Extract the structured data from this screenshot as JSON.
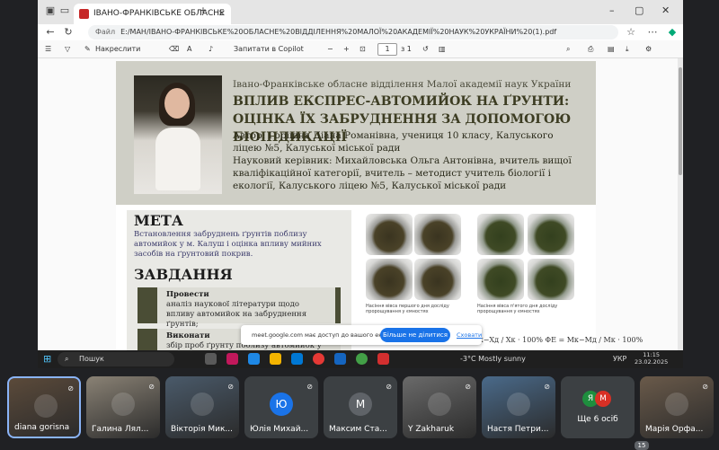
{
  "browser": {
    "tab_title": "ІВАНО-ФРАНКІВСЬКЕ ОБЛАСНЕ",
    "address_prefix": "Файл",
    "url": "E:/МАН/ІВАНО-ФРАНКІВСЬКЕ%20ОБЛАСНЕ%20ВІДДІЛЕННЯ%20МАЛОЇ%20АКАДЕМІЇ%20НАУК%20УКРАЇНИ%20(1).pdf"
  },
  "pdf_toolbar": {
    "highlight": "Накреслити",
    "ask_copilot": "Запитати в Copilot",
    "page": "1",
    "of_pages": "з 1"
  },
  "poster": {
    "org": "Івано-Франківське обласне відділення Малої академії наук України",
    "title": "ВПЛИВ ЕКСПРЕС-АВТОМИЙОК НА ҐРУНТИ: ОЦІНКА ЇХ ЗАБРУДНЕННЯ ЗА ДОПОМОГОЮ БІОІНДИКАЦІЇ",
    "author": "Автор: Горішна Діана Романівна, учениця 10 класу, Калуського ліцею №5, Калуської міської ради",
    "supervisor": "Науковий керівник: Михайловська Ольга Антонівна, вчитель вищої кваліфікаційної категорії, вчитель – методист учитель біології і екології, Калуського ліцею №5, Калуської міської ради",
    "goal_heading": "МЕТА",
    "goal_text": "Встановлення забруднень ґрунтів поблизу автомийок у м. Калуш і оцінка впливу мийних засобів на ґрунтовий покрив.",
    "tasks_heading": "ЗАВДАННЯ",
    "task1_label": "Провести",
    "task1_text": "аналіз наукової літератури щодо впливу автомийок на забруднення ґрунтів;",
    "task2_label": "Виконати",
    "task2_text": "збір проб ґрунту поблизу автомийок у",
    "caption1": "Насіння вівса першого дня досліду пророщування у ємностях",
    "caption2": "Насіння вівса п'ятого дня досліду пророщування у ємностях",
    "formula": "Xк−Xд / Xк · 100%   ΦЕ = Mк−Mд / Mк · 100%"
  },
  "share_bar": {
    "message": "meet.google.com має доступ до вашого екрана.",
    "stop": "Більше не ділитися",
    "hide": "Сховати"
  },
  "taskbar": {
    "search": "Пошук",
    "weather": "-3°C  Mostly sunny",
    "lang": "УКР",
    "time": "11:15",
    "date": "23.02.2025"
  },
  "participants": [
    {
      "name": "diana gorisna",
      "initial": "",
      "color": "#5b4a3a"
    },
    {
      "name": "Галина Лял...",
      "initial": "",
      "color": "#8a8275"
    },
    {
      "name": "Вікторія Мик...",
      "initial": "",
      "color": "#4a5a6a"
    },
    {
      "name": "Юлія Михай...",
      "initial": "Ю",
      "color": "#1a73e8"
    },
    {
      "name": "Максим Ста...",
      "initial": "М",
      "color": "#5f6368"
    },
    {
      "name": "Y Zakharuk",
      "initial": "",
      "color": "#6a6a6a"
    },
    {
      "name": "Настя Петри...",
      "initial": "",
      "color": "#4a6a8a"
    },
    {
      "name": "Ще 6 осіб",
      "initial": "",
      "color": ""
    },
    {
      "name": "Марія Орфа...",
      "initial": "",
      "color": "#6a5a4a"
    }
  ],
  "more_avatars": [
    "Я",
    "М"
  ],
  "participant_count": "15"
}
